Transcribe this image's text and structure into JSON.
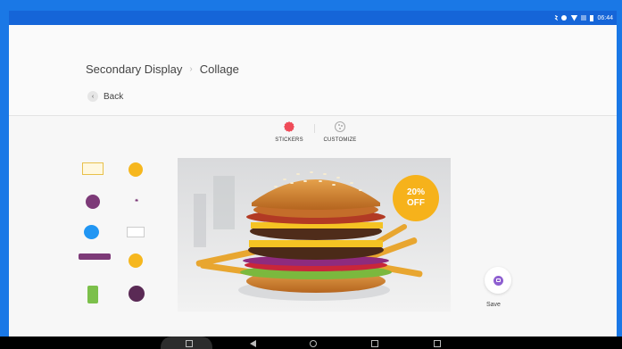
{
  "status_bar": {
    "time": "06:44",
    "icons": [
      "bluetooth-icon",
      "data-saver-icon",
      "wifi-icon",
      "signal-icon",
      "battery-icon"
    ]
  },
  "breadcrumb": {
    "parent": "Secondary Display",
    "separator": "›",
    "current": "Collage"
  },
  "back": {
    "label": "Back"
  },
  "tabs": [
    {
      "label": "STICKERS",
      "icon": "sticker-icon",
      "color": "#ef4b58",
      "active": true
    },
    {
      "label": "CUSTOMIZE",
      "icon": "palette-icon",
      "color": "#aaaaaa",
      "active": false
    }
  ],
  "stickers": [
    {
      "icon": "rect-badge-sticker-icon"
    },
    {
      "icon": "yellow-circle-sticker-icon"
    },
    {
      "icon": "purple-circle-sticker-icon"
    },
    {
      "icon": "quote-sticker-icon"
    },
    {
      "icon": "blue-bubble-sticker-icon"
    },
    {
      "icon": "label-sticker-icon"
    },
    {
      "icon": "purple-band-sticker-icon"
    },
    {
      "icon": "yellow-bubble-sticker-icon"
    },
    {
      "icon": "green-tag-sticker-icon"
    },
    {
      "icon": "dark-circle-sticker-icon"
    }
  ],
  "collage": {
    "image": "burger-photo",
    "badge": {
      "line1": "20%",
      "line2": "OFF",
      "color": "#f6b21b"
    }
  },
  "save": {
    "label": "Save",
    "icon": "save-icon",
    "color": "#8e5fd0"
  },
  "nav_bar": {
    "icons": [
      "screenshot-icon",
      "back-icon",
      "home-icon",
      "recents-icon",
      "volume-icon"
    ]
  },
  "colors": {
    "accent_blue": "#1565d8",
    "frame_blue": "#1a78e6",
    "background": "#f7f7f7"
  }
}
